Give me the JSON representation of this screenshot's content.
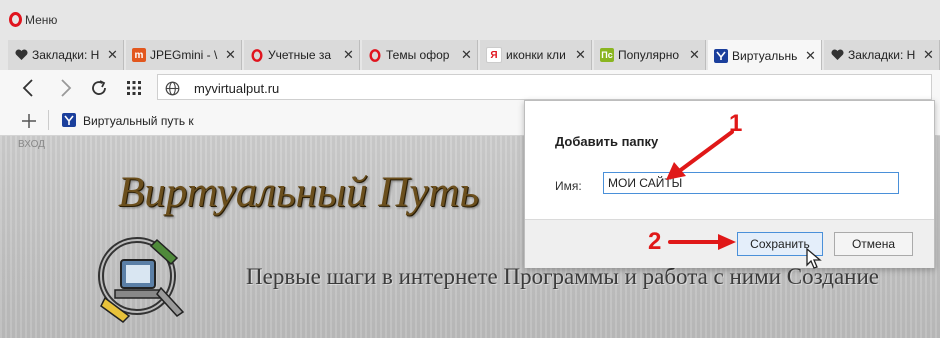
{
  "window": {
    "menu_label": "Меню"
  },
  "tabs": [
    {
      "title": "Закладки: Н",
      "icon": "heart-icon",
      "fav": "",
      "fav_color": ""
    },
    {
      "title": "JPEGmini - \\",
      "icon": "jpegmini-icon",
      "fav": "m",
      "fav_color": "#e2571e"
    },
    {
      "title": "Учетные за",
      "icon": "opera-icon",
      "fav": "",
      "fav_color": ""
    },
    {
      "title": "Темы офор",
      "icon": "opera-icon",
      "fav": "",
      "fav_color": ""
    },
    {
      "title": "иконки кли",
      "icon": "yandex-icon",
      "fav": "Я",
      "fav_color": "#ffffff"
    },
    {
      "title": "Популярно",
      "icon": "pc-icon",
      "fav": "Пс",
      "fav_color": "#8ab520"
    },
    {
      "title": "Виртуальнь",
      "icon": "site-icon",
      "fav": "",
      "fav_color": "#1b3f9c",
      "active": true
    },
    {
      "title": "Закладки: Н",
      "icon": "heart-icon",
      "fav": "",
      "fav_color": ""
    }
  ],
  "address": {
    "url": "myvirtualput.ru"
  },
  "bookmarks": {
    "item_label": "Виртуальный путь к"
  },
  "page": {
    "vhod": "ВХОД",
    "site_title": "Виртуальный Путь",
    "tagline": "Первые шаги в интернете Программы и работа с ними Создание"
  },
  "dialog": {
    "title": "Добавить папку",
    "name_label": "Имя:",
    "name_value": "МОИ САЙТЫ",
    "save_label": "Сохранить",
    "cancel_label": "Отмена"
  },
  "annotations": {
    "step1": "1",
    "step2": "2"
  },
  "colors": {
    "accent": "#4a90d9",
    "annotation": "#e01818",
    "opera_red": "#e0141e"
  }
}
